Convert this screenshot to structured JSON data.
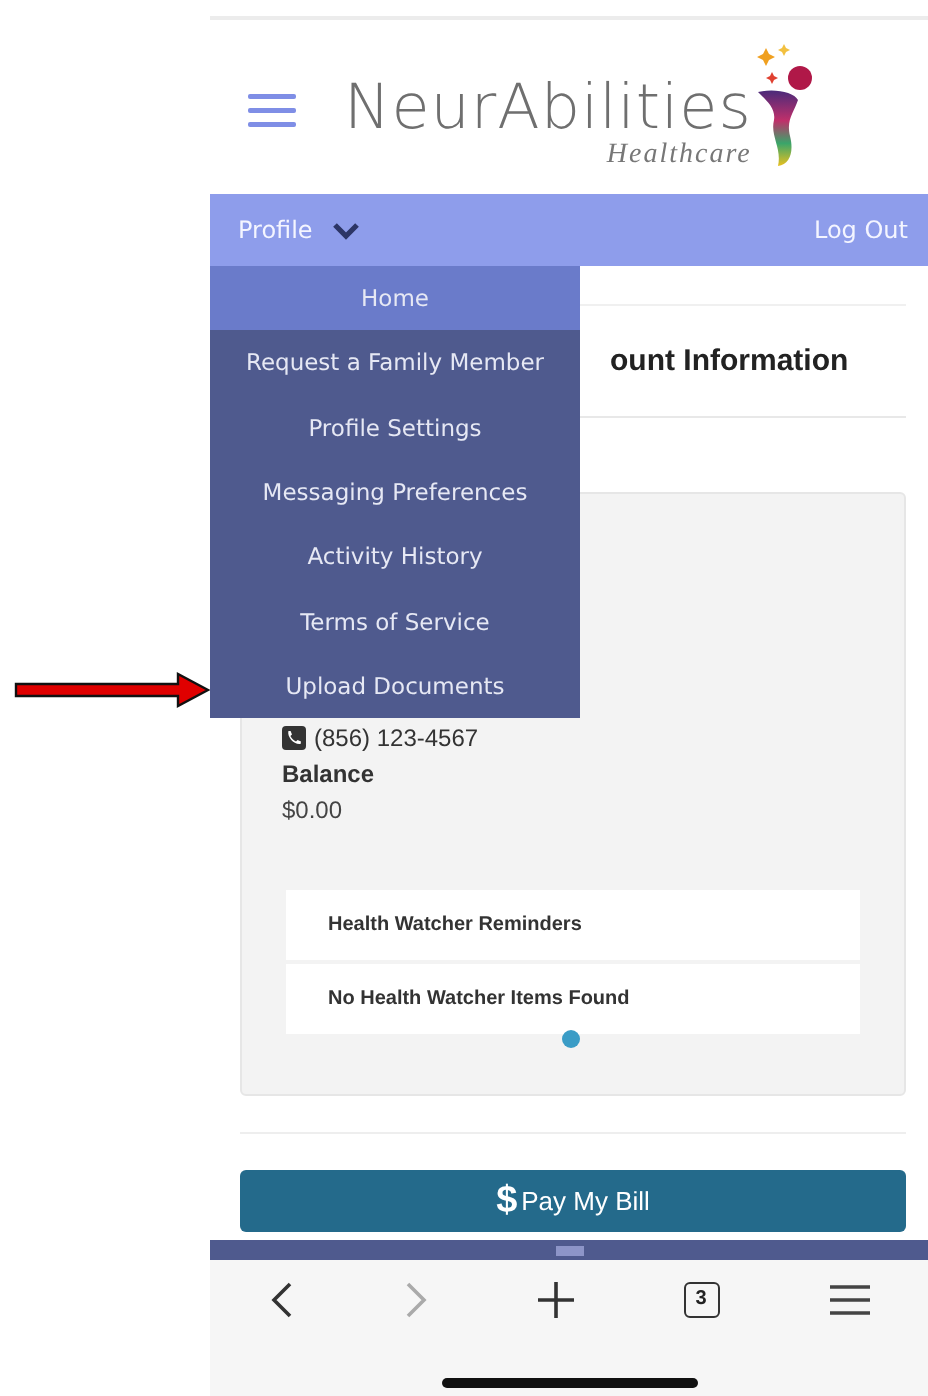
{
  "logo": {
    "name": "NeurAbilities",
    "tagline": "Healthcare"
  },
  "nav": {
    "profile": "Profile",
    "logout": "Log Out",
    "expanded": true
  },
  "menu": [
    {
      "label": "Home",
      "selected": true
    },
    {
      "label": "Request a Family Member",
      "selected": false
    },
    {
      "label": "Profile Settings",
      "selected": false
    },
    {
      "label": "Messaging Preferences",
      "selected": false
    },
    {
      "label": "Activity History",
      "selected": false
    },
    {
      "label": "Terms of Service",
      "selected": false
    },
    {
      "label": "Upload Documents",
      "selected": false
    }
  ],
  "page_title": "ount Information",
  "account": {
    "phone": "(856) 123-4567",
    "balance_label": "Balance",
    "balance": "$0.00"
  },
  "reminders": {
    "title": "Health Watcher Reminders",
    "empty": "No Health Watcher Items Found"
  },
  "pay_button": {
    "symbol": "$",
    "label": "Pay My Bill"
  },
  "browser": {
    "tab_count": "3"
  }
}
